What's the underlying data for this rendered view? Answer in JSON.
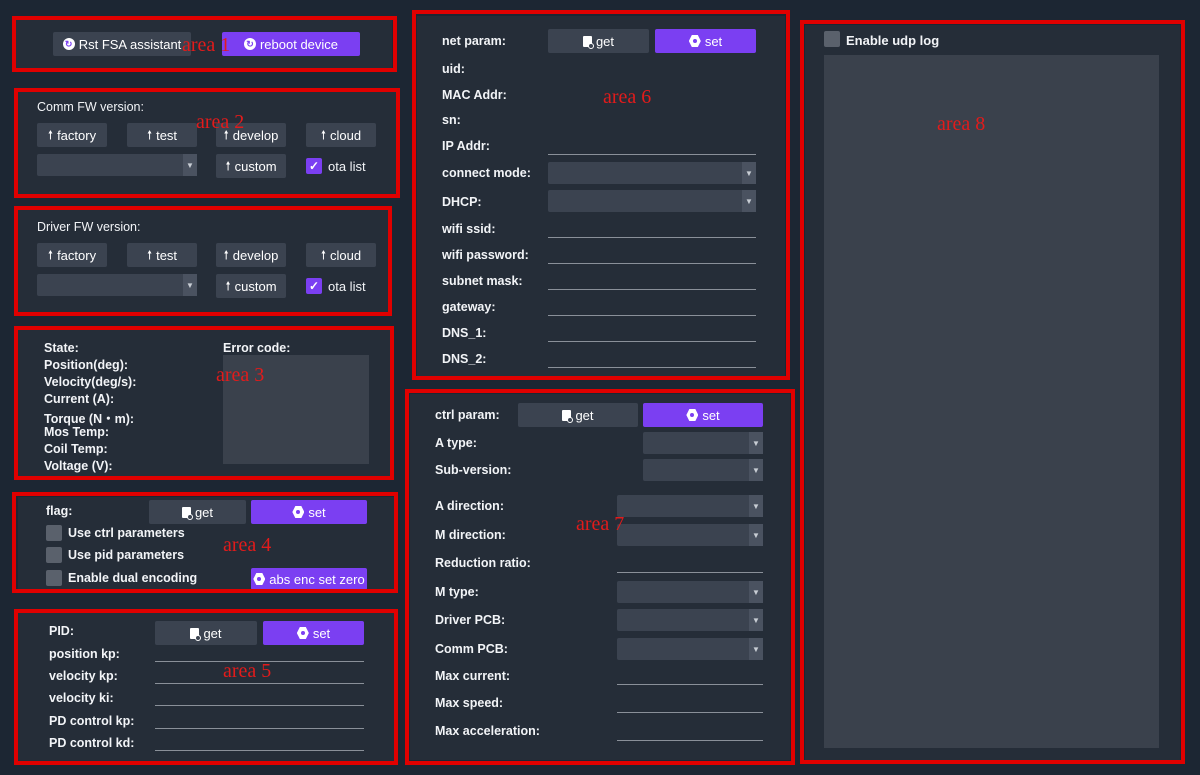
{
  "area_labels": [
    "area 1",
    "area 2",
    "area 3",
    "area 4",
    "area 5",
    "area 6",
    "area 7",
    "area 8"
  ],
  "area1": {
    "rst_button": "Rst FSA assistant",
    "reboot_button": "reboot device"
  },
  "comm_fw": {
    "title": "Comm FW version:",
    "factory": "factory",
    "test": "test",
    "develop": "develop",
    "cloud": "cloud",
    "custom": "custom",
    "ota_list": "ota list",
    "ota_checked": true,
    "selected": ""
  },
  "driver_fw": {
    "title": "Driver FW version:",
    "factory": "factory",
    "test": "test",
    "develop": "develop",
    "cloud": "cloud",
    "custom": "custom",
    "ota_list": "ota list",
    "ota_checked": true,
    "selected": ""
  },
  "status": {
    "labels": [
      "State:",
      "Position(deg):",
      "Velocity(deg/s):",
      "Current (A):",
      "Torque (N・m):",
      "Mos Temp:",
      "Coil Temp:",
      "Voltage (V):"
    ],
    "error_code": "Error code:"
  },
  "flag": {
    "title": "flag:",
    "get": "get",
    "set": "set",
    "use_ctrl": "Use ctrl parameters",
    "use_pid": "Use pid parameters",
    "dual_encoding": "Enable dual encoding",
    "abs_enc": "abs enc set zero"
  },
  "pid": {
    "title": "PID:",
    "get": "get",
    "set": "set",
    "fields": [
      "position kp:",
      "velocity kp:",
      "velocity ki:",
      "PD control kp:",
      "PD control kd:"
    ]
  },
  "net": {
    "title": "net param:",
    "get": "get",
    "set": "set",
    "uid": "uid:",
    "mac": "MAC Addr:",
    "sn": "sn:",
    "ip": "IP Addr:",
    "connect_mode": "connect mode:",
    "dhcp": "DHCP:",
    "wifi_ssid": "wifi ssid:",
    "wifi_password": "wifi password:",
    "subnet_mask": "subnet mask:",
    "gateway": "gateway:",
    "dns1": "DNS_1:",
    "dns2": "DNS_2:"
  },
  "ctrl": {
    "title": "ctrl param:",
    "get": "get",
    "set": "set",
    "a_type": "A type:",
    "sub_version": "Sub-version:",
    "a_direction": "A direction:",
    "m_direction": "M direction:",
    "reduction_ratio": "Reduction ratio:",
    "m_type": "M type:",
    "driver_pcb": "Driver PCB:",
    "comm_pcb": "Comm PCB:",
    "max_current": "Max current:",
    "max_speed": "Max speed:",
    "max_acceleration": "Max acceleration:"
  },
  "log": {
    "enable_udp_log": "Enable udp log",
    "checked": false
  },
  "colors": {
    "accent": "#7b3ff2",
    "highlight_box": "#e00000",
    "background": "#1c2633",
    "panel": "#252d38"
  }
}
